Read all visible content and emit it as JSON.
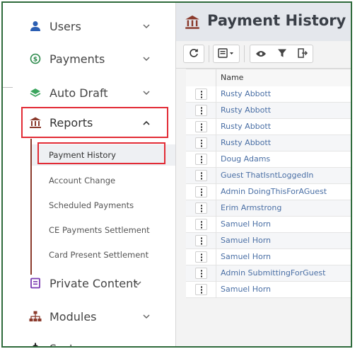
{
  "sidebar": {
    "items": [
      {
        "label": "Users",
        "icon": "user-icon",
        "expanded": false
      },
      {
        "label": "Payments",
        "icon": "dollar-circle-icon",
        "expanded": false
      },
      {
        "label": "Auto Draft",
        "icon": "layers-icon",
        "expanded": false
      },
      {
        "label": "Reports",
        "icon": "bank-icon",
        "expanded": true
      },
      {
        "label": "Private Content",
        "icon": "book-icon",
        "expanded": false
      },
      {
        "label": "Modules",
        "icon": "sitemap-icon",
        "expanded": false
      },
      {
        "label": "System",
        "icon": "gear-icon",
        "expanded": false
      }
    ],
    "reports_submenu": [
      {
        "label": "Payment History",
        "active": true
      },
      {
        "label": "Account Change"
      },
      {
        "label": "Scheduled Payments"
      },
      {
        "label": "CE Payments Settlement"
      },
      {
        "label": "Card Present Settlement"
      }
    ]
  },
  "main": {
    "title": "Payment History",
    "title_icon": "bank-icon",
    "toolbar": [
      "refresh-icon",
      "columns-dropdown-icon",
      "eye-icon",
      "filter-icon",
      "export-icon"
    ],
    "grid": {
      "columns": [
        "Name"
      ],
      "rows": [
        "Rusty Abbott",
        "Rusty Abbott",
        "Rusty Abbott",
        "Rusty Abbott",
        "Doug Adams",
        "Guest ThatIsntLoggedIn",
        "Admin DoingThisForAGuest",
        "Erim Armstrong",
        "Samuel Horn",
        "Samuel Horn",
        "Samuel Horn",
        "Admin SubmittingForGuest",
        "Samuel Horn"
      ]
    }
  },
  "colors": {
    "frame": "#2f6b3c",
    "highlight": "#e22b35",
    "link": "#4a6fa5",
    "brown": "#8b3a2c"
  }
}
